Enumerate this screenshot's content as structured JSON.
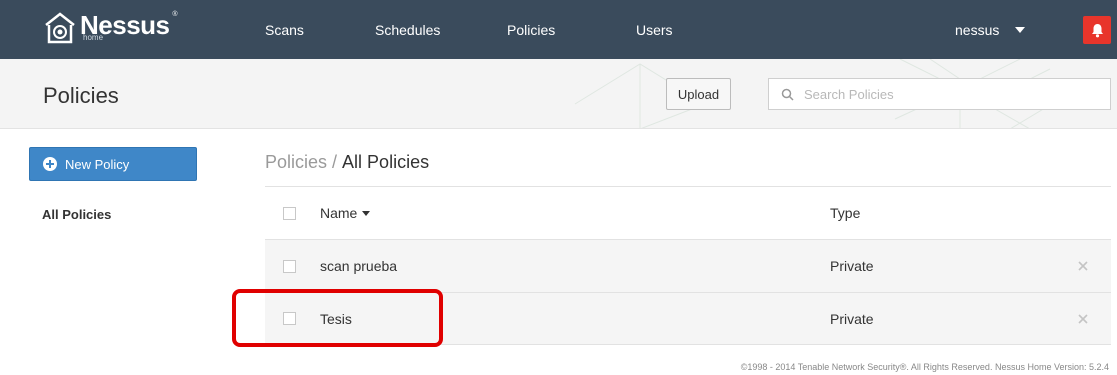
{
  "brand": {
    "name": "Nessus",
    "sub": "home",
    "registered": "®"
  },
  "nav": {
    "scans": "Scans",
    "schedules": "Schedules",
    "policies": "Policies",
    "users": "Users",
    "user": "nessus"
  },
  "icons": {
    "alert": "bell-icon",
    "search": "search-icon",
    "add": "plus-circle-icon",
    "delete": "close-icon"
  },
  "colors": {
    "topbar": "#3a4b5c",
    "accent": "#3f87c8",
    "alert": "#e8352b",
    "highlight": "#e00000"
  },
  "title_bar": {
    "title": "Policies",
    "upload_label": "Upload",
    "search_placeholder": "Search Policies"
  },
  "sidebar": {
    "new_policy_label": "New Policy",
    "all_policies_label": "All Policies"
  },
  "breadcrumb": {
    "parent": "Policies",
    "separator": "/",
    "current": "All Policies"
  },
  "table": {
    "headers": {
      "name": "Name",
      "type": "Type"
    },
    "rows": [
      {
        "name": "scan prueba",
        "type": "Private"
      },
      {
        "name": "Tesis",
        "type": "Private"
      }
    ]
  },
  "footer": {
    "text": "©1998 - 2014 Tenable Network Security®. All Rights Reserved. Nessus Home Version: 5.2.4"
  }
}
